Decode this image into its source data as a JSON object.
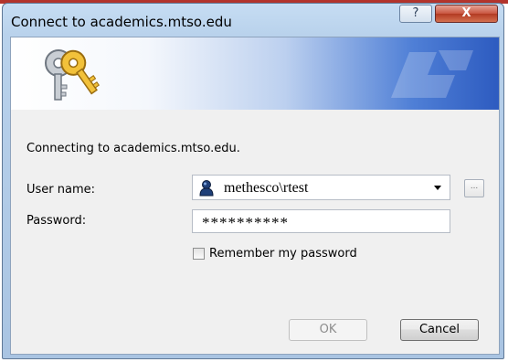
{
  "window": {
    "title": "Connect to academics.mtso.edu",
    "help_glyph": "?",
    "close_glyph": "X"
  },
  "banner": {
    "icon": "keys-icon"
  },
  "form": {
    "connecting_text": "Connecting to academics.mtso.edu.",
    "user_label": "User name:",
    "user_value": "methesco\\rtest",
    "user_icon": "user-account-icon",
    "browse_label": "...",
    "password_label": "Password:",
    "password_value": "**********",
    "remember_label": "Remember my password",
    "remember_checked": false
  },
  "buttons": {
    "ok_label": "OK",
    "cancel_label": "Cancel"
  },
  "colors": {
    "close_red": "#c8553f",
    "banner_blue": "#2d5bc0",
    "frame_blue": "#b9d2ec"
  }
}
